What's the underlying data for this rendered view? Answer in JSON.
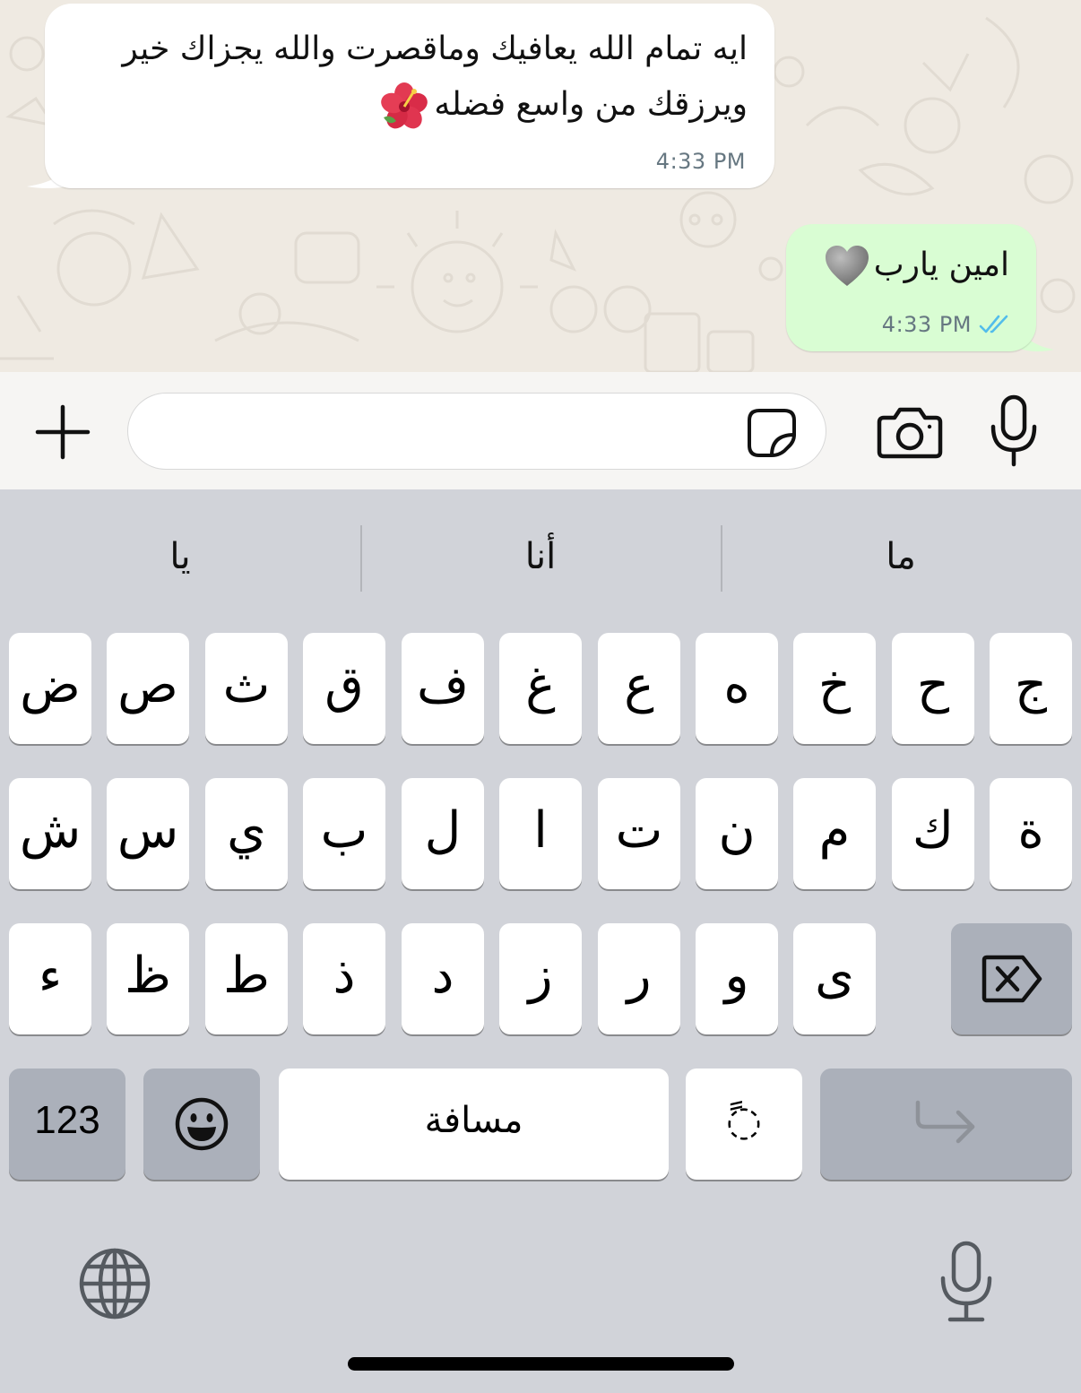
{
  "chat": {
    "incoming": {
      "line1": "ايه تمام الله يعافيك وماقصرت والله يجزاك خير",
      "line2": "ويرزقك من واسع فضله",
      "emoji": "hibiscus",
      "time": "4:33 PM"
    },
    "outgoing": {
      "text": "امين يارب",
      "emoji": "grey-heart",
      "time": "4:33 PM",
      "status": "read"
    }
  },
  "composer": {
    "input_value": "",
    "icons": [
      "plus-icon",
      "sticker-icon",
      "camera-icon",
      "microphone-icon"
    ]
  },
  "keyboard": {
    "suggestions": [
      "ما",
      "أنا",
      "يا"
    ],
    "row1": [
      "ج",
      "ح",
      "خ",
      "ه",
      "ع",
      "غ",
      "ف",
      "ق",
      "ث",
      "ص",
      "ض"
    ],
    "row2": [
      "ة",
      "ك",
      "م",
      "ن",
      "ت",
      "ا",
      "ل",
      "ب",
      "ي",
      "س",
      "ش"
    ],
    "row3": [
      "ى",
      "و",
      "ر",
      "ز",
      "د",
      "ذ",
      "ط",
      "ظ",
      "ء"
    ],
    "numbers_label": "123",
    "space_label": "مسافة",
    "diacritic_label": "ً◌",
    "icons": [
      "backspace-icon",
      "emoji-icon",
      "return-icon",
      "globe-icon",
      "dictation-icon"
    ]
  },
  "colors": {
    "chat_background": "#efeae2",
    "incoming_bubble": "#ffffff",
    "outgoing_bubble": "#d9fdd3",
    "read_ticks": "#53bdeb",
    "keyboard_background": "#d1d3d9",
    "special_key": "#abb0ba"
  }
}
